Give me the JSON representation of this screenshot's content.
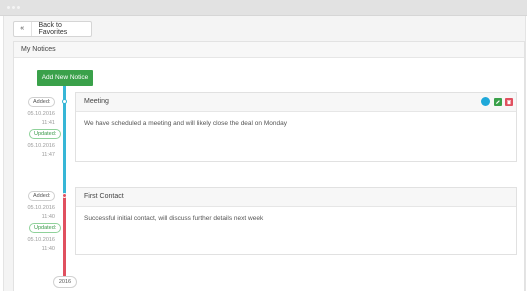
{
  "window": {
    "dots": 3
  },
  "toolbar": {
    "back_label": "Back to Favorites"
  },
  "panel": {
    "title": "My Notices"
  },
  "add_button": {
    "label": "Add New Notice"
  },
  "notices": [
    {
      "title": "Meeting",
      "body": "We have scheduled a meeting and will likely close the deal on Monday",
      "added_tag": "Added:",
      "added_date": "05.10.2016",
      "added_time": "11:41",
      "updated_tag": "Updated:",
      "updated_date": "05.10.2016",
      "updated_time": "11:47",
      "color": "#37b6d6"
    },
    {
      "title": "First Contact",
      "body": "Successful initial contact, will discuss further details next week",
      "added_tag": "Added:",
      "added_date": "05.10.2016",
      "added_time": "11:40",
      "updated_tag": "Updated:",
      "updated_date": "05.10.2016",
      "updated_time": "11:40",
      "color": "#e0505f"
    }
  ],
  "timeline": {
    "year": "2016"
  },
  "actions": {
    "info_icon": "info-icon",
    "edit_icon": "edit-icon",
    "delete_icon": "trash-icon"
  },
  "colors": {
    "primary": "#3aa14a",
    "timeline_blue": "#37b6d6",
    "timeline_red": "#e0505f"
  }
}
